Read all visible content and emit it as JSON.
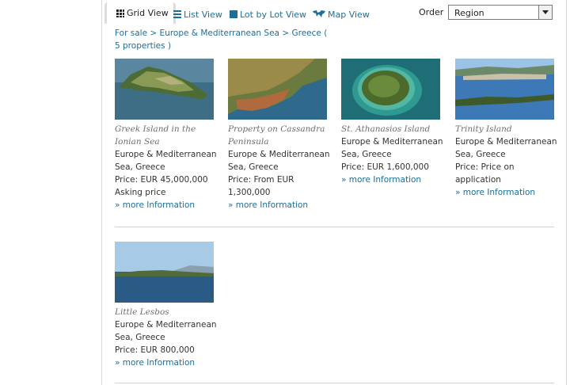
{
  "toolbar": {
    "tabs": [
      {
        "label": "Grid View",
        "icon": "grid-icon",
        "active": true
      },
      {
        "label": "List View",
        "icon": "list-icon"
      },
      {
        "label": "Lot by Lot View",
        "icon": "square-icon"
      },
      {
        "label": "Map View",
        "icon": "map-icon"
      }
    ],
    "order_label": "Order",
    "order_value": "Region"
  },
  "breadcrumb": {
    "prefix": "For sale",
    "separator": ">",
    "region": "Europe & Mediterranean Sea",
    "country": "Greece",
    "count": "( 5 properties )"
  },
  "properties": [
    {
      "title": "Greek Island in the Ionian Sea",
      "location": "Europe & Mediterranean Sea, Greece",
      "price": "Price: EUR 45,000,000 Asking price",
      "link": "» more Information"
    },
    {
      "title": "Property on Cassandra Peninsula",
      "location": "Europe & Mediterranean Sea, Greece",
      "price": "Price: From EUR 1,300,000",
      "link": "» more Information"
    },
    {
      "title": "St. Athanasios Island",
      "location": "Europe & Mediterranean Sea, Greece",
      "price": "Price: EUR 1,600,000",
      "link": "» more Information"
    },
    {
      "title": "Trinity Island",
      "location": "Europe & Mediterranean Sea, Greece",
      "price": "Price: Price on application",
      "link": "» more Information"
    },
    {
      "title": "Little Lesbos",
      "location": "Europe & Mediterranean Sea, Greece",
      "price": "Price: EUR 800,000",
      "link": "» more Information"
    }
  ]
}
